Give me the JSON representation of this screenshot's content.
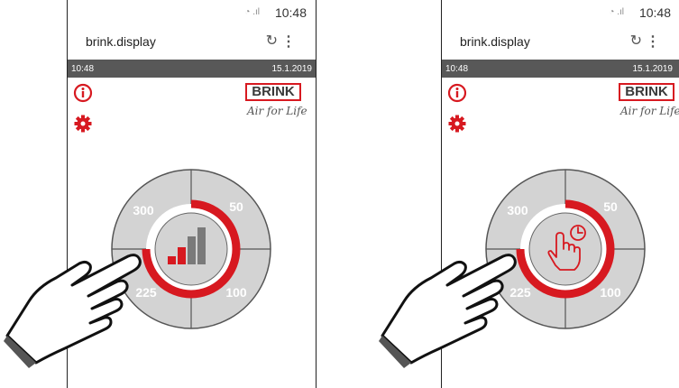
{
  "screens": [
    {
      "status_time": "10:48",
      "url": "brink.display",
      "info_time": "10:48",
      "info_date": "15.1.2019",
      "logo_text": "BRINK",
      "logo_tagline": "Air for Life",
      "segments": [
        "300",
        "50",
        "225",
        "100"
      ],
      "center_icon": "signal-bars-icon"
    },
    {
      "status_time": "10:48",
      "url": "brink.display",
      "info_time": "10:48",
      "info_date": "15.1.2019",
      "logo_text": "BRINK",
      "logo_tagline": "Air for Life",
      "segments": [
        "300",
        "50",
        "225",
        "100"
      ],
      "center_icon": "hand-timer-icon"
    }
  ],
  "colors": {
    "accent": "#d71920",
    "dial_fill": "#d3d3d3",
    "header_bar": "#585858"
  }
}
